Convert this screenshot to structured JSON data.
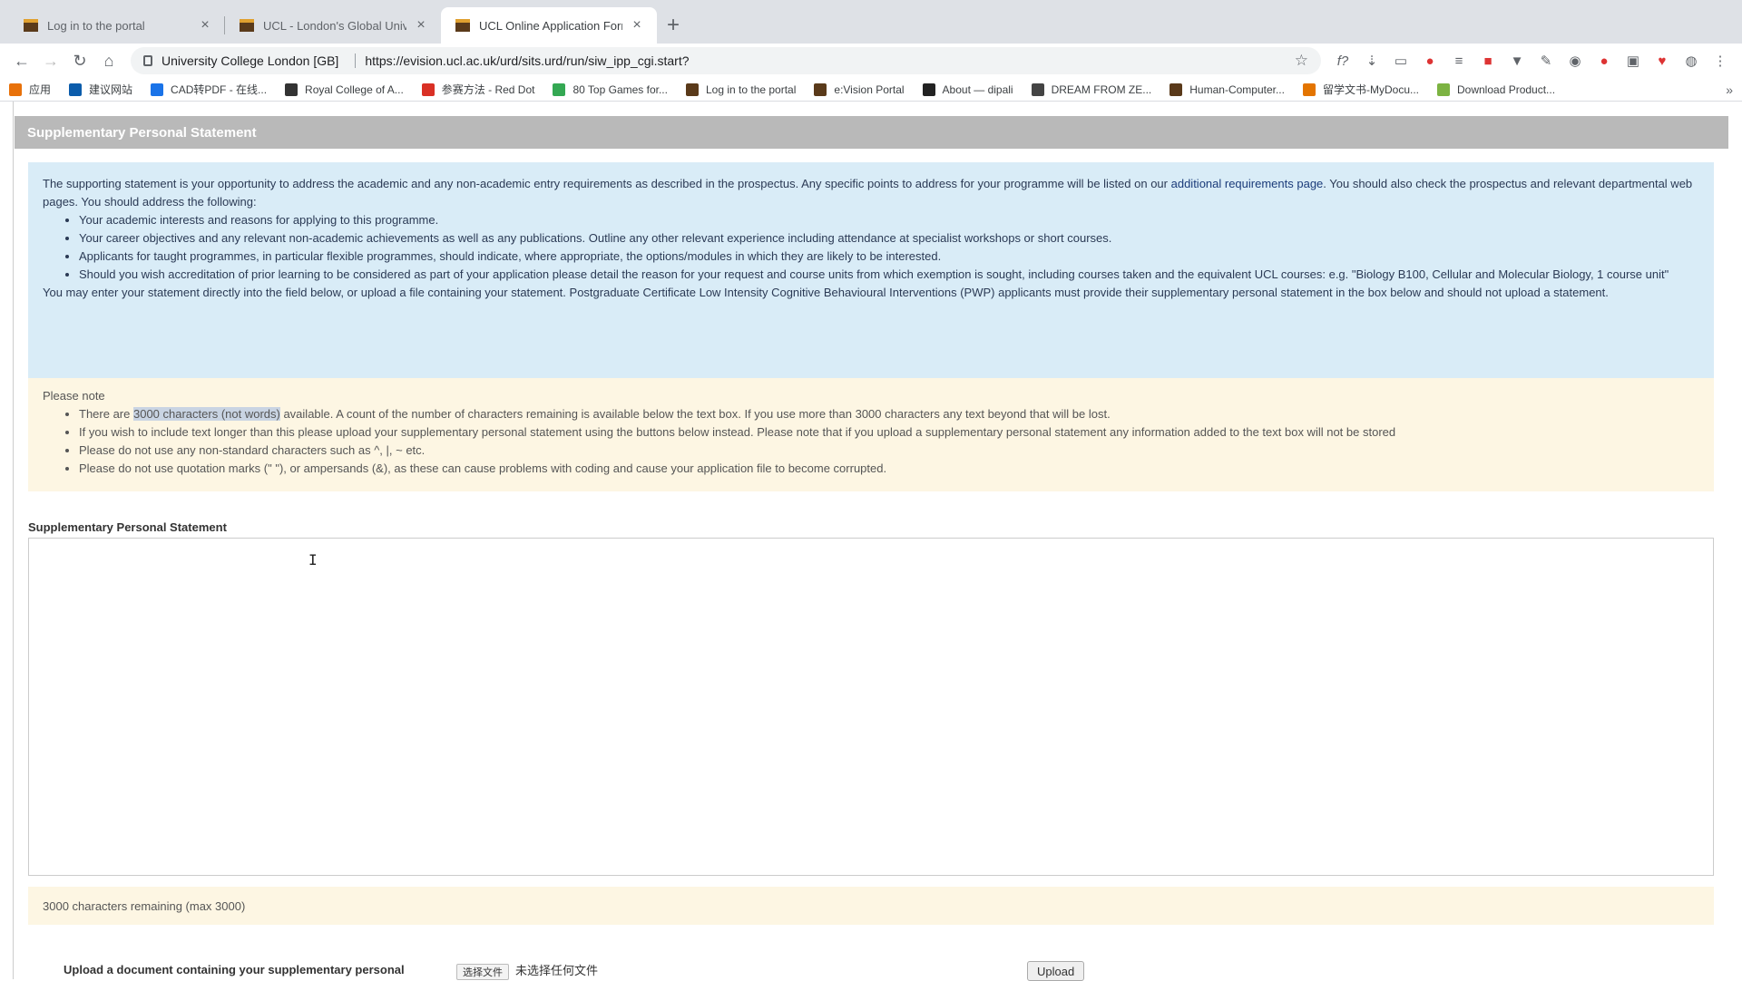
{
  "browser": {
    "tabs": [
      {
        "title": "Log in to the portal",
        "active": false
      },
      {
        "title": "UCL - London's Global Univer",
        "active": false
      },
      {
        "title": "UCL Online Application Form",
        "active": true
      }
    ],
    "address": {
      "org": "University College London [GB]",
      "url": "https://evision.ucl.ac.uk/urd/sits.urd/run/siw_ipp_cgi.start?"
    },
    "bookmarks": [
      {
        "label": "应用",
        "icon": "apps-grid-icon",
        "color": "#e8710a"
      },
      {
        "label": "建议网站",
        "icon": "bing-icon",
        "color": "#0b5cab"
      },
      {
        "label": "CAD转PDF - 在线...",
        "icon": "globe-icon",
        "color": "#1a73e8"
      },
      {
        "label": "Royal College of A...",
        "icon": "rca-icon",
        "color": "#333333"
      },
      {
        "label": "参赛方法 - Red Dot",
        "icon": "reddot-icon",
        "color": "#d93025"
      },
      {
        "label": "80 Top Games for...",
        "icon": "games-icon",
        "color": "#34a853"
      },
      {
        "label": "Log in to the portal",
        "icon": "ucl-icon",
        "color": "#5a3a1a"
      },
      {
        "label": "e:Vision Portal",
        "icon": "ucl-icon",
        "color": "#5a3a1a"
      },
      {
        "label": "About — dipali",
        "icon": "dv-icon",
        "color": "#222222"
      },
      {
        "label": "DREAM FROM ZE...",
        "icon": "cube-icon",
        "color": "#444444"
      },
      {
        "label": "Human-Computer...",
        "icon": "ucl-icon",
        "color": "#5a3a1a"
      },
      {
        "label": "留学文书-MyDocu...",
        "icon": "doc-icon",
        "color": "#e37400"
      },
      {
        "label": "Download Product...",
        "icon": "leaf-icon",
        "color": "#7cb342"
      }
    ]
  },
  "page": {
    "section_title": "Supplementary Personal Statement",
    "info": {
      "intro_pre": "The supporting statement is your opportunity to address the academic and any non-academic entry requirements as described in the prospectus. Any specific points to address for your programme will be listed on our ",
      "intro_link": "additional requirements page",
      "intro_post": ". You should also check the prospectus and relevant departmental web pages. You should address the following:",
      "bullets": [
        "Your academic interests and reasons for applying to this programme.",
        "Your career objectives and any relevant non-academic achievements as well as any publications. Outline any other relevant experience including attendance at specialist workshops or short courses.",
        "Applicants for taught programmes, in particular flexible programmes, should indicate, where appropriate, the options/modules in which they are likely to be interested.",
        "Should you wish accreditation of prior learning to be considered as part of your application please detail the reason for your request and course units from which exemption is sought, including courses taken and the equivalent UCL courses: e.g. \"Biology B100, Cellular and Molecular Biology, 1 course unit\""
      ],
      "outro": "You may enter your statement directly into the field below, or upload a file containing your statement. Postgraduate Certificate Low Intensity Cognitive Behavioural Interventions (PWP) applicants must provide their supplementary personal statement in the box below and should not upload a statement."
    },
    "note": {
      "heading": "Please note",
      "b1_pre": "There are ",
      "b1_highlight": "3000 characters (not words)",
      "b1_post": " available. A count of the number of characters remaining is available below the text box. If you use more than 3000 characters any text beyond that will be lost.",
      "b2": "If you wish to include text longer than this please upload your supplementary personal statement using the buttons below instead. Please note that if you upload a supplementary personal statement any information added to the text box will not be stored",
      "b3": "Please do not use any non-standard characters such as ^, |, ~ etc.",
      "b4": "Please do not use quotation marks (\" \"), or ampersands (&), as these can cause problems with coding and cause your application file to become corrupted."
    },
    "field_label": "Supplementary Personal Statement",
    "textarea_value": "",
    "remaining": "3000 characters remaining (max 3000)",
    "upload": {
      "label": "Upload a document containing your supplementary personal",
      "choose_file": "选择文件",
      "no_file": "未选择任何文件",
      "button": "Upload"
    }
  }
}
